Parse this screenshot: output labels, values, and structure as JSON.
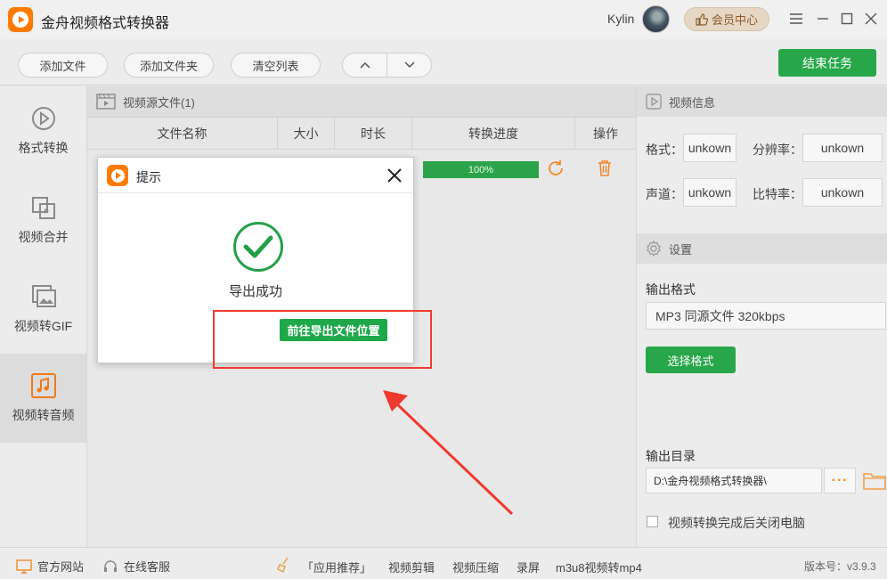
{
  "app": {
    "title": "金舟视频格式转换器",
    "username": "Kylin",
    "vip_label": "会员中心"
  },
  "toolbar": {
    "add_file": "添加文件",
    "add_folder": "添加文件夹",
    "clear_list": "清空列表",
    "end_task": "结束任务"
  },
  "sidebar": {
    "items": [
      {
        "label": "格式转换",
        "icon": "play-circle-icon"
      },
      {
        "label": "视频合并",
        "icon": "merge-icon"
      },
      {
        "label": "视频转GIF",
        "icon": "image-icon"
      },
      {
        "label": "视频转音频",
        "icon": "music-icon"
      }
    ],
    "active_index": 3
  },
  "file_list": {
    "title": "视频源文件(1)",
    "columns": [
      "文件名称",
      "大小",
      "时长",
      "转换进度",
      "操作"
    ],
    "rows": [
      {
        "progress_label": "100%",
        "progress": 1.0
      }
    ]
  },
  "video_info": {
    "title": "视频信息",
    "format_label": "格式：",
    "format_value": "unkown",
    "resolution_label": "分辨率：",
    "resolution_value": "unkown",
    "channel_label": "声道：",
    "channel_value": "unkown",
    "bitrate_label": "比特率：",
    "bitrate_value": "unkown"
  },
  "settings": {
    "title": "设置",
    "output_format_label": "输出格式",
    "output_format_value": "MP3 同源文件 320kbps",
    "choose_format": "选择格式",
    "output_dir_label": "输出目录",
    "output_dir_value": "D:\\金舟视频格式转换器\\",
    "shutdown_label": "视频转换完成后关闭电脑"
  },
  "footer": {
    "website": "官方网站",
    "support": "在线客服",
    "app_recommend": "「应用推荐」",
    "links": [
      "视频剪辑",
      "视频压缩",
      "录屏",
      "m3u8视频转mp4"
    ],
    "version": "版本号：v3.9.3"
  },
  "dialog": {
    "title": "提示",
    "message": "导出成功",
    "goto_button": "前往导出文件位置"
  },
  "colors": {
    "accent_green": "#27a74a",
    "brand_orange": "#ff7a00",
    "annotation_red": "#f03a2e"
  }
}
